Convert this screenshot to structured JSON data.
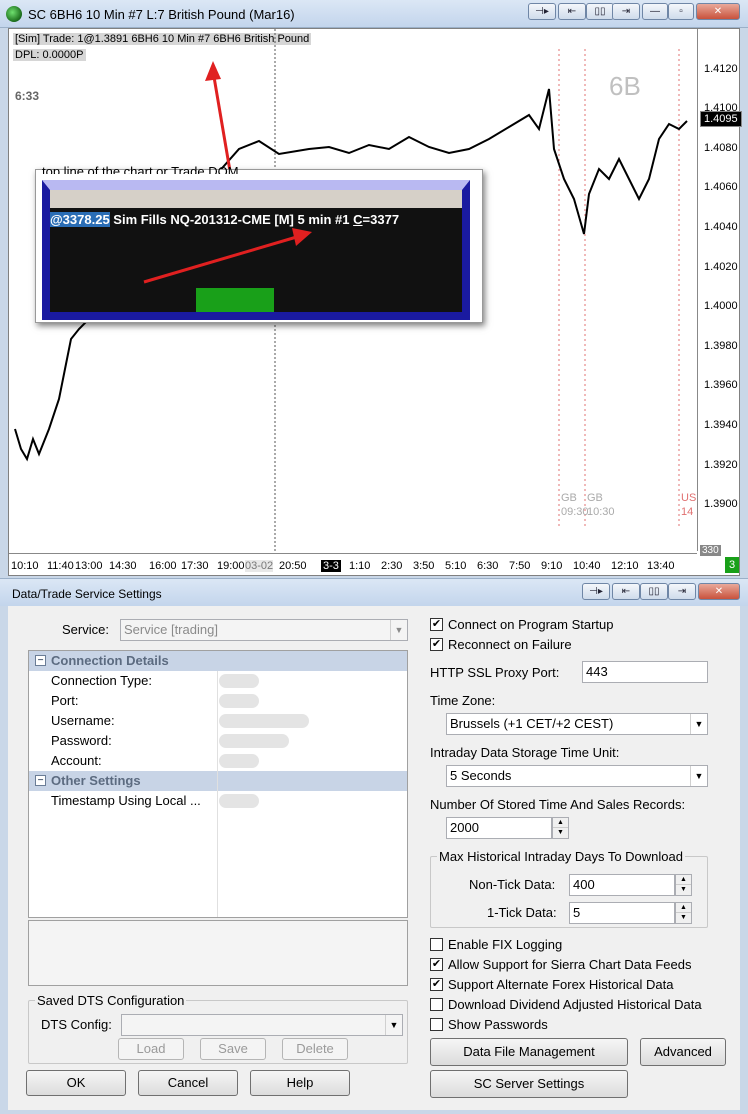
{
  "window": {
    "title": "SC 6BH6  10 Min  #7  L:7  British Pound (Mar16)",
    "buttons": [
      "⊣▸",
      "⇤",
      "▯▯",
      "⇥",
      "—",
      "▫",
      "✕"
    ]
  },
  "chart": {
    "header_line1": "[Sim]  Trade: 1@1.3891  6BH6  10 Min  #7 6BH6 British Pound",
    "header_line2": "DPL: 0.0000P",
    "time_left": "6:33",
    "watermark": "6B",
    "current_price": "1.4095",
    "y_ticks": [
      "1.4120",
      "1.4100",
      "1.4080",
      "1.4060",
      "1.4040",
      "1.4020",
      "1.4000",
      "1.3980",
      "1.3960",
      "1.3940",
      "1.3920",
      "1.3900"
    ],
    "x_ticks": [
      "10:10",
      "11:40",
      "13:00",
      "14:30",
      "16:00",
      "17:30",
      "19:00",
      "03-02",
      "20:50",
      "3-3",
      "1:10",
      "2:30",
      "3:50",
      "5:10",
      "6:30",
      "7:50",
      "9:10",
      "10:40",
      "12:10",
      "13:40"
    ],
    "corner_value": "330",
    "corner_badge": "3",
    "markers": [
      {
        "label1": "GB",
        "label2": "09:30"
      },
      {
        "label1": "GB",
        "label2": "10:30"
      },
      {
        "label1": "US",
        "label2": "14"
      }
    ],
    "callout": {
      "top_text": "top line of the chart or Trade DOM.",
      "price_highlight": "@3378.25",
      "rest": " Sim Fills  NQ-201312-CME [M]  5 min   #1 ",
      "c_label": "C",
      "c_value": "=3377"
    }
  },
  "dialog": {
    "title": "Data/Trade Service Settings",
    "service_label": "Service:",
    "service_value": "Service   [trading]",
    "sections": {
      "connection": "Connection Details",
      "other": "Other Settings"
    },
    "rows": [
      "Connection Type:",
      "Port:",
      "Username:",
      "Password:",
      "Account:"
    ],
    "other_rows": [
      "Timestamp Using Local ..."
    ],
    "saved_group": "Saved DTS Configuration",
    "dts_config_label": "DTS Config:",
    "load": "Load",
    "save": "Save",
    "delete": "Delete",
    "ok": "OK",
    "cancel": "Cancel",
    "help": "Help",
    "connect_startup": "Connect on Program Startup",
    "reconnect": "Reconnect on Failure",
    "proxy_label": "HTTP SSL Proxy Port:",
    "proxy_value": "443",
    "timezone_label": "Time Zone:",
    "timezone_value": "Brussels (+1 CET/+2 CEST)",
    "storage_label": "Intraday Data Storage Time Unit:",
    "storage_value": "5 Seconds",
    "records_label": "Number Of Stored Time And Sales Records:",
    "records_value": "2000",
    "max_hist_group": "Max Historical Intraday Days To Download",
    "nontick_label": "Non-Tick Data:",
    "nontick_value": "400",
    "onetick_label": "1-Tick Data:",
    "onetick_value": "5",
    "fix_logging": "Enable FIX Logging",
    "sierra_feeds": "Allow Support for Sierra Chart Data Feeds",
    "forex": "Support Alternate Forex Historical Data",
    "dividend": "Download Dividend Adjusted Historical Data",
    "show_passwords": "Show Passwords",
    "data_file_mgmt": "Data File Management",
    "advanced": "Advanced",
    "sc_server": "SC Server Settings"
  }
}
